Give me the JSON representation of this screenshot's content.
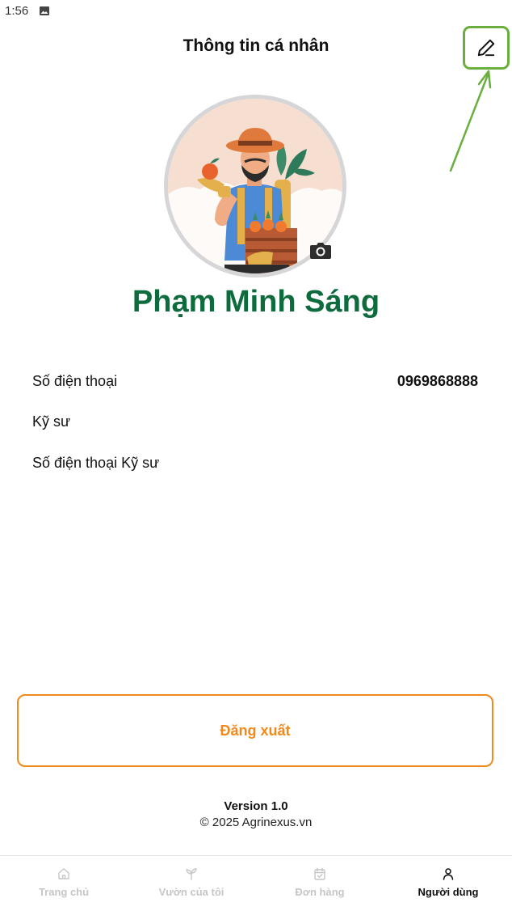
{
  "status_bar": {
    "time": "1:56",
    "icons": [
      "image-icon"
    ]
  },
  "header": {
    "title": "Thông tin cá nhân",
    "edit_icon": "pencil-icon"
  },
  "profile": {
    "name": "Phạm Minh Sáng",
    "avatar_icon": "farmer-avatar",
    "camera_icon": "camera-icon"
  },
  "info": [
    {
      "label": "Số điện thoại",
      "value": "0969868888"
    },
    {
      "label": "Kỹ sư",
      "value": ""
    },
    {
      "label": "Số điện thoại Kỹ sư",
      "value": ""
    }
  ],
  "logout_label": "Đăng xuất",
  "footer": {
    "version": "Version 1.0",
    "copyright": "© 2025 Agrinexus.vn"
  },
  "bottom_nav": [
    {
      "label": "Trang chủ",
      "icon": "home-icon",
      "active": false
    },
    {
      "label": "Vườn của tôi",
      "icon": "plant-icon",
      "active": false
    },
    {
      "label": "Đơn hàng",
      "icon": "calendar-check-icon",
      "active": false
    },
    {
      "label": "Người dùng",
      "icon": "user-icon",
      "active": true
    }
  ],
  "colors": {
    "name_green": "#0d6b3d",
    "logout_orange": "#f08a1c",
    "edit_highlight": "#6aaf3d"
  }
}
